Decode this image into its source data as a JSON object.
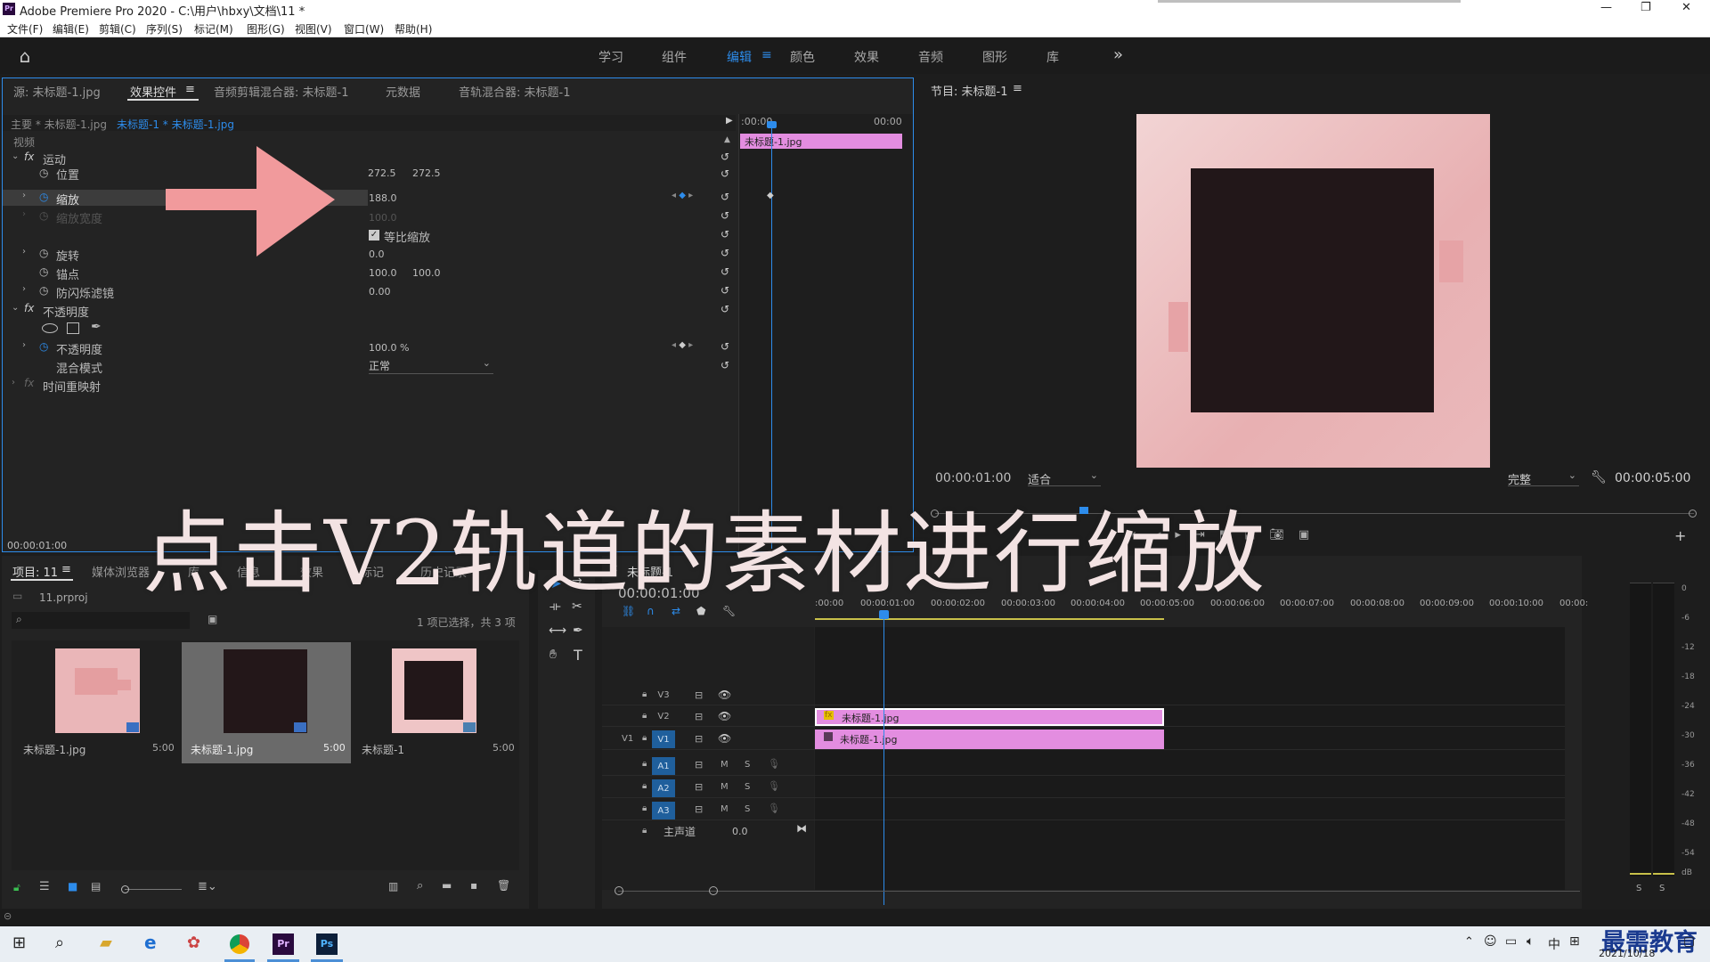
{
  "titlebar": {
    "app_title": "Adobe Premiere Pro 2020 - C:\\用户\\hbxy\\文档\\11 *",
    "minimize": "—",
    "maximize": "❐",
    "close": "✕"
  },
  "menu": [
    "文件(F)",
    "编辑(E)",
    "剪辑(C)",
    "序列(S)",
    "标记(M)",
    "图形(G)",
    "视图(V)",
    "窗口(W)",
    "帮助(H)"
  ],
  "workspaces": [
    "学习",
    "组件",
    "编辑",
    "颜色",
    "效果",
    "音频",
    "图形",
    "库"
  ],
  "workspace_menu_icon": "≡",
  "workspace_more": "»",
  "ec_tabs": [
    "源: 未标题-1.jpg",
    "效果控件",
    "音频剪辑混合器: 未标题-1",
    "元数据",
    "音轨混合器: 未标题-1"
  ],
  "ec_tab_menu": "≡",
  "ec": {
    "master": "主要 * 未标题-1.jpg",
    "clip": "未标题-1 * 未标题-1.jpg",
    "ruler_start": ":00:00",
    "ruler_end": "00:00",
    "clip_bar": "未标题-1.jpg",
    "video_header": "视频",
    "motion": "运动",
    "position": "位置",
    "pos_x": "272.5",
    "pos_y": "272.5",
    "scale": "缩放",
    "scale_val": "188.0",
    "scale_width": "缩放宽度",
    "scale_width_val": "100.0",
    "uniform": "等比缩放",
    "rotation": "旋转",
    "rotation_val": "0.0",
    "anchor": "锚点",
    "anchor_x": "100.0",
    "anchor_y": "100.0",
    "flicker": "防闪烁滤镜",
    "flicker_val": "0.00",
    "opacity_group": "不透明度",
    "opacity": "不透明度",
    "opacity_val": "100.0 %",
    "blend": "混合模式",
    "blend_val": "正常",
    "time_remap": "时间重映射",
    "timecode": "00:00:01:00",
    "fx": "fx"
  },
  "program": {
    "title": "节目: 未标题-1",
    "timecode": "00:00:01:00",
    "fit": "适合",
    "quality": "完整",
    "duration": "00:00:05:00"
  },
  "project_tabs": [
    "项目: 11",
    "媒体浏览器",
    "库",
    "信息",
    "效果",
    "标记",
    "历史记录"
  ],
  "project": {
    "file": "11.prproj",
    "selection": "1 项已选择，共 3 项",
    "items": [
      {
        "name": "未标题-1.jpg",
        "dur": "5:00"
      },
      {
        "name": "未标题-1.jpg",
        "dur": "5:00"
      },
      {
        "name": "未标题-1",
        "dur": "5:00"
      }
    ]
  },
  "timeline": {
    "tab": "未标题-1",
    "timecode": "00:00:01:00",
    "ruler": [
      ":00:00",
      "00:00:01:00",
      "00:00:02:00",
      "00:00:03:00",
      "00:00:04:00",
      "00:00:05:00",
      "00:00:06:00",
      "00:00:07:00",
      "00:00:08:00",
      "00:00:09:00",
      "00:00:10:00",
      "00:00:1"
    ],
    "tracks": [
      "V3",
      "V2",
      "V1",
      "A1",
      "A2",
      "A3"
    ],
    "v1_src": "V1",
    "master": "主声道",
    "master_val": "0.0",
    "clip_v2": "未标题-1.jpg",
    "clip_v1": "未标题-1.jpg",
    "m": "M",
    "s": "S"
  },
  "meter": {
    "scale": [
      "0",
      "-6",
      "-12",
      "-18",
      "-24",
      "-30",
      "-36",
      "-42",
      "-48",
      "-54",
      "dB"
    ],
    "solo": [
      "S",
      "S"
    ]
  },
  "overlay_text": "点击V2轨道的素材进行缩放",
  "taskbar": {
    "ime": "中",
    "date": "2021/10/18",
    "watermark": "最需教育"
  },
  "colors": {
    "accent": "#2d8ceb",
    "clip_pink": "#e38de0",
    "arrow": "#f19a9c",
    "frame_pink": "#efc5c6",
    "frame_dark": "#221719"
  }
}
